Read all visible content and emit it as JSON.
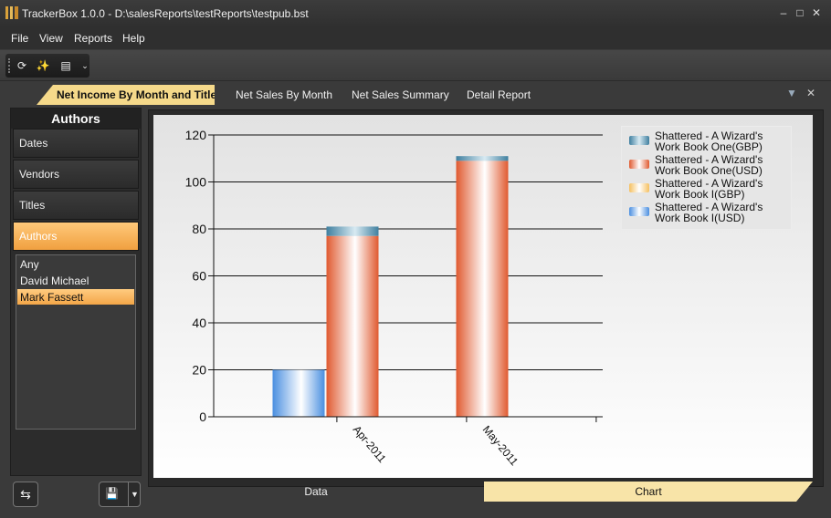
{
  "window": {
    "title": "TrackerBox 1.0.0 - D:\\salesReports\\testReports\\testpub.bst",
    "minimize_icon": "minimize-icon",
    "maximize_icon": "maximize-icon",
    "close_icon": "close-icon"
  },
  "menu": [
    "File",
    "View",
    "Reports",
    "Help"
  ],
  "toolbar": {
    "icons": [
      "refresh-chart-icon",
      "magic-wand-icon",
      "chart-icon",
      "chevron-down-icon"
    ]
  },
  "tabs": {
    "active": "Net Income By Month and Title",
    "others": [
      "Net Sales By Month",
      "Net Sales Summary",
      "Detail Report"
    ]
  },
  "sidebar": {
    "header": "Authors",
    "buttons": [
      "Dates",
      "Vendors",
      "Titles",
      "Authors"
    ],
    "active_button": "Authors",
    "list": [
      "Any",
      "David Michael",
      "Mark Fassett"
    ],
    "selected": "Mark Fassett"
  },
  "bottom_tabs": {
    "data": "Data",
    "chart": "Chart",
    "active": "Chart"
  },
  "chart_data": {
    "type": "bar",
    "stacked": true,
    "categories": [
      "Apr-2011",
      "May-2011"
    ],
    "series": [
      {
        "name": "Shattered - A Wizard's Work Book One(GBP)",
        "color": "#5e9fbe",
        "values": [
          4,
          2
        ]
      },
      {
        "name": "Shattered - A Wizard's Work Book One(USD)",
        "color": "#e05a30",
        "values": [
          77,
          109
        ]
      },
      {
        "name": "Shattered - A Wizard's Work Book I(GBP)",
        "color": "#f5c060",
        "values": [
          0,
          0
        ]
      },
      {
        "name": "Shattered - A Wizard's Work Book I(USD)",
        "color": "#4a8fe0",
        "values": [
          20,
          0
        ]
      }
    ],
    "yticks": [
      0,
      20,
      40,
      60,
      80,
      100,
      120
    ],
    "ylim": [
      0,
      120
    ],
    "grid": true,
    "legend": "top-right"
  }
}
